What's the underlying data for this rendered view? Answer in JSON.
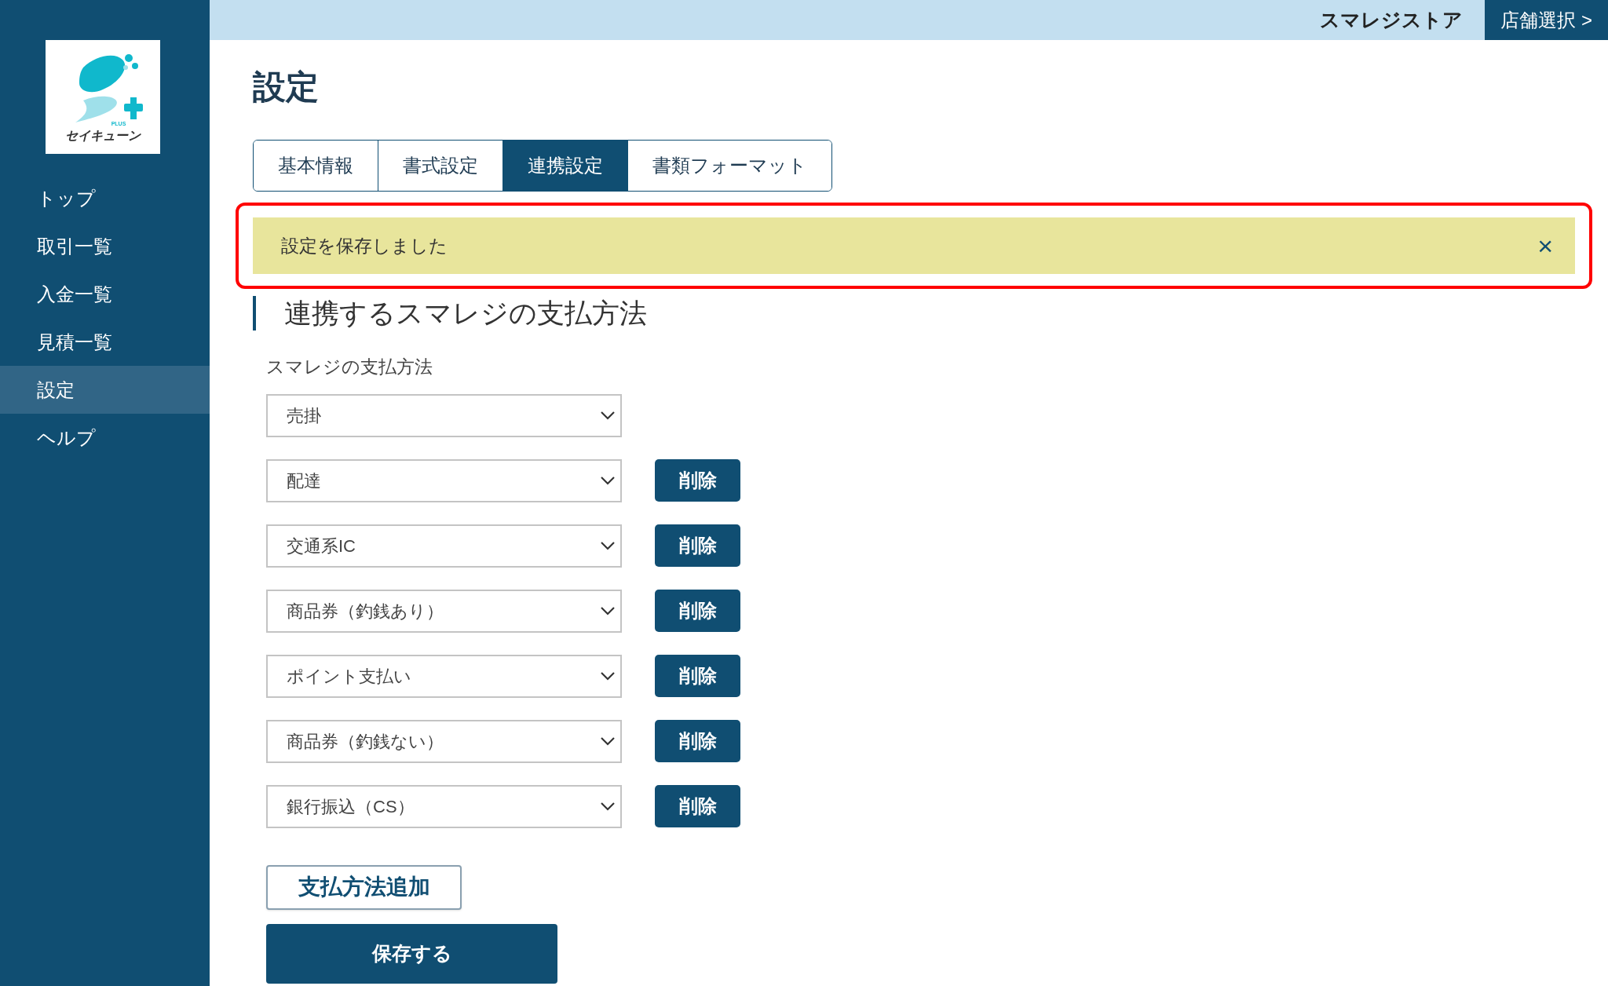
{
  "logo": {
    "wordmark": "セイキューン",
    "badge": "PLUS"
  },
  "sidebar": {
    "items": [
      {
        "label": "トップ",
        "selected": false
      },
      {
        "label": "取引一覧",
        "selected": false
      },
      {
        "label": "入金一覧",
        "selected": false
      },
      {
        "label": "見積一覧",
        "selected": false
      },
      {
        "label": "設定",
        "selected": true
      },
      {
        "label": "ヘルプ",
        "selected": false
      }
    ]
  },
  "header": {
    "store_name": "スマレジストア",
    "store_select": "店舗選択 >"
  },
  "page_title": "設定",
  "tabs": [
    {
      "label": "基本情報",
      "selected": false
    },
    {
      "label": "書式設定",
      "selected": false
    },
    {
      "label": "連携設定",
      "selected": true
    },
    {
      "label": "書類フォーマット",
      "selected": false
    }
  ],
  "alert": {
    "message": "設定を保存しました",
    "close": "×",
    "highlighted": true
  },
  "section": {
    "title": "連携するスマレジの支払方法",
    "field_label": "スマレジの支払方法",
    "rows": [
      {
        "value": "売掛"
      },
      {
        "value": "配達",
        "delete_label": "削除"
      },
      {
        "value": "交通系IC",
        "delete_label": "削除"
      },
      {
        "value": "商品券（釣銭あり）",
        "delete_label": "削除"
      },
      {
        "value": "ポイント支払い",
        "delete_label": "削除"
      },
      {
        "value": "商品券（釣銭ない）",
        "delete_label": "削除"
      },
      {
        "value": "銀行振込（CS）",
        "delete_label": "削除"
      }
    ],
    "add_button": "支払方法追加",
    "save_button": "保存する"
  }
}
